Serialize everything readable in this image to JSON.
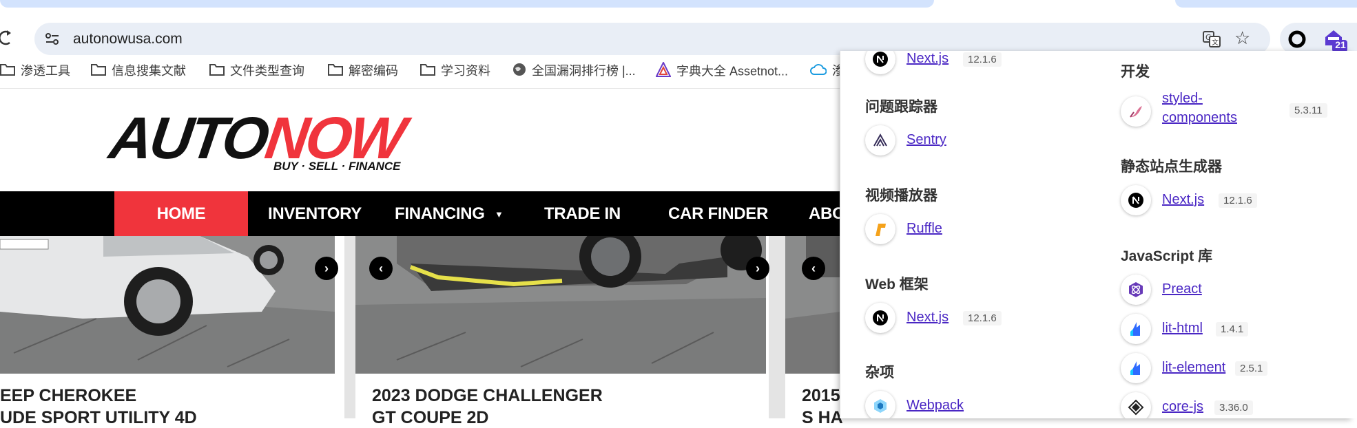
{
  "browser": {
    "url": "autonowusa.com",
    "extension_badge": "21"
  },
  "bookmarks": [
    {
      "label": "渗透工具",
      "icon": "folder-icon"
    },
    {
      "label": "信息搜集文献",
      "icon": "folder-icon"
    },
    {
      "label": "文件类型查询",
      "icon": "folder-icon"
    },
    {
      "label": "解密编码",
      "icon": "folder-icon"
    },
    {
      "label": "学习资料",
      "icon": "folder-icon"
    },
    {
      "label": "全国漏洞排行榜 |...",
      "icon": "globe-icon"
    },
    {
      "label": "字典大全 Assetnot...",
      "icon": "assetnote-icon"
    },
    {
      "label": "渗",
      "icon": "cloud-icon"
    }
  ],
  "site": {
    "logo_main_black": "AUTO",
    "logo_main_red": "NOW",
    "logo_tagline": "BUY · SELL · FINANCE",
    "nav": [
      "HOME",
      "INVENTORY",
      "FINANCING",
      "TRADE IN",
      "CAR FINDER",
      "ABO"
    ],
    "nav_dropdown_marker": "▼",
    "cards": [
      {
        "title_line1": "EEP CHEROKEE",
        "title_line2": "UDE SPORT UTILITY 4D"
      },
      {
        "title_line1": "2023 DODGE CHALLENGER",
        "title_line2": "GT COUPE 2D"
      },
      {
        "title_line1": "2015",
        "title_line2": "S HA"
      }
    ]
  },
  "wappalyzer": {
    "left_column": [
      {
        "category": null,
        "items": [
          {
            "name": "Next.js",
            "version": "12.1.6",
            "icon": "nextjs-icon"
          }
        ]
      },
      {
        "category": "问题跟踪器",
        "items": [
          {
            "name": "Sentry",
            "version": "",
            "icon": "sentry-icon"
          }
        ]
      },
      {
        "category": "视频播放器",
        "items": [
          {
            "name": "Ruffle",
            "version": "",
            "icon": "ruffle-icon"
          }
        ]
      },
      {
        "category": "Web 框架",
        "items": [
          {
            "name": "Next.js",
            "version": "12.1.6",
            "icon": "nextjs-icon"
          }
        ]
      },
      {
        "category": "杂项",
        "items": [
          {
            "name": "Webpack",
            "version": "",
            "icon": "webpack-icon"
          }
        ]
      }
    ],
    "right_column": [
      {
        "category": "开发",
        "items": [
          {
            "name_line1": "styled-",
            "name_line2": "components",
            "version": "5.3.11",
            "icon": "styled-components-icon"
          }
        ]
      },
      {
        "category": "静态站点生成器",
        "items": [
          {
            "name": "Next.js",
            "version": "12.1.6",
            "icon": "nextjs-icon"
          }
        ]
      },
      {
        "category": "JavaScript 库",
        "items": [
          {
            "name": "Preact",
            "version": "",
            "icon": "preact-icon"
          },
          {
            "name": "lit-html",
            "version": "1.4.1",
            "icon": "lit-icon"
          },
          {
            "name": "lit-element",
            "version": "2.5.1",
            "icon": "lit-icon"
          },
          {
            "name": "core-js",
            "version": "3.36.0",
            "icon": "corejs-icon"
          }
        ]
      }
    ]
  },
  "colors": {
    "accent_red": "#f0343c",
    "link_purple": "#4a27c4",
    "omnibox_bg": "#e9eef6"
  }
}
